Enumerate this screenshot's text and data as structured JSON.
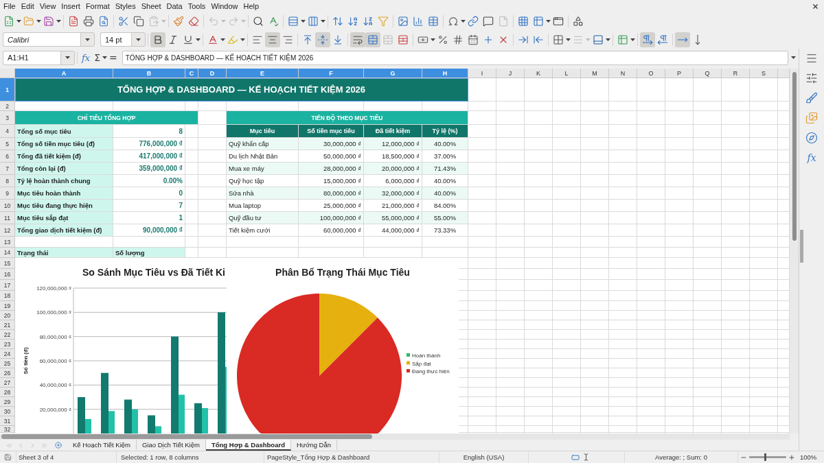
{
  "menu_bar": {
    "items": [
      "File",
      "Edit",
      "View",
      "Insert",
      "Format",
      "Styles",
      "Sheet",
      "Data",
      "Tools",
      "Window",
      "Help"
    ]
  },
  "standard_toolbar": {
    "paste_enabled": false,
    "undo_enabled": false,
    "redo_enabled": false,
    "headers_footers_enabled": false
  },
  "formatting_toolbar": {
    "font_name": "Calibri",
    "font_size": "14 pt",
    "bold": true,
    "italic": false,
    "underline": false,
    "align_left": false,
    "align_center": true,
    "align_right": false,
    "valign_top": false,
    "valign_center": true,
    "valign_bottom": false,
    "wrap_text": true,
    "merge_center": true,
    "merge_enabled": false,
    "border_style_enabled": false,
    "left_to_right": true,
    "right_to_left": false,
    "text_horizontal": true,
    "text_vertical": false
  },
  "formula_bar": {
    "name_box": "A1:H1",
    "function_wizard": "fx",
    "sum": "Σ",
    "formula": "=",
    "content": "TỔNG HỢP & DASHBOARD — KẾ HOẠCH TIẾT KIỆM 2026"
  },
  "sheet": {
    "columns": [
      {
        "label": "A",
        "selected": true
      },
      {
        "label": "B",
        "selected": true
      },
      {
        "label": "C",
        "selected": true
      },
      {
        "label": "D",
        "selected": true
      },
      {
        "label": "E",
        "selected": true
      },
      {
        "label": "F",
        "selected": true
      },
      {
        "label": "G",
        "selected": true
      },
      {
        "label": "H",
        "selected": true
      },
      {
        "label": "I",
        "selected": false
      },
      {
        "label": "J",
        "selected": false
      },
      {
        "label": "K",
        "selected": false
      },
      {
        "label": "L",
        "selected": false
      },
      {
        "label": "M",
        "selected": false
      },
      {
        "label": "N",
        "selected": false
      },
      {
        "label": "O",
        "selected": false
      },
      {
        "label": "P",
        "selected": false
      },
      {
        "label": "Q",
        "selected": false
      },
      {
        "label": "R",
        "selected": false
      },
      {
        "label": "S",
        "selected": false
      }
    ],
    "rows": [
      {
        "label": "1",
        "selected": true
      },
      {
        "label": "2",
        "selected": false
      },
      {
        "label": "3",
        "selected": false
      },
      {
        "label": "4",
        "selected": false
      },
      {
        "label": "5",
        "selected": false
      },
      {
        "label": "6",
        "selected": false
      },
      {
        "label": "7",
        "selected": false
      },
      {
        "label": "8",
        "selected": false
      },
      {
        "label": "9",
        "selected": false
      },
      {
        "label": "10",
        "selected": false
      },
      {
        "label": "11",
        "selected": false
      },
      {
        "label": "12",
        "selected": false
      },
      {
        "label": "13",
        "selected": false
      },
      {
        "label": "14",
        "selected": false
      },
      {
        "label": "15",
        "selected": false
      },
      {
        "label": "16",
        "selected": false
      },
      {
        "label": "17",
        "selected": false
      },
      {
        "label": "18",
        "selected": false
      },
      {
        "label": "19",
        "selected": false
      },
      {
        "label": "20",
        "selected": false
      },
      {
        "label": "21",
        "selected": false
      },
      {
        "label": "22",
        "selected": false
      },
      {
        "label": "23",
        "selected": false
      },
      {
        "label": "24",
        "selected": false
      },
      {
        "label": "25",
        "selected": false
      },
      {
        "label": "26",
        "selected": false
      },
      {
        "label": "27",
        "selected": false
      },
      {
        "label": "28",
        "selected": false
      },
      {
        "label": "29",
        "selected": false
      },
      {
        "label": "30",
        "selected": false
      },
      {
        "label": "31",
        "selected": false
      },
      {
        "label": "32",
        "selected": false
      }
    ],
    "title": "TỔNG HỢP & DASHBOARD — KẾ HOẠCH TIẾT KIỆM 2026",
    "summary": {
      "header": "CHỈ TIÊU TỔNG HỢP",
      "items": [
        {
          "label": "Tổng số mục tiêu",
          "value": "8"
        },
        {
          "label": "Tổng số tiền mục tiêu (đ)",
          "value": "776,000,000 ₫"
        },
        {
          "label": "Tổng đã tiết kiệm (đ)",
          "value": "417,000,000 ₫"
        },
        {
          "label": "Tổng còn lại (đ)",
          "value": "359,000,000 ₫"
        },
        {
          "label": "Tỷ lệ hoàn thành chung",
          "value": "0.00%"
        },
        {
          "label": "Mục tiêu hoàn thành",
          "value": "0"
        },
        {
          "label": "Mục tiêu đang thực hiện",
          "value": "7"
        },
        {
          "label": "Mục tiêu sắp đạt",
          "value": "1"
        },
        {
          "label": "Tổng giao dịch tiết kiệm (đ)",
          "value": "90,000,000 ₫"
        }
      ]
    },
    "progress": {
      "header": "TIẾN ĐỘ THEO MỤC TIÊU",
      "columns": [
        "Mục tiêu",
        "Số tiền mục tiêu",
        "Đã tiết kiệm",
        "Tỷ lệ (%)"
      ],
      "rows": [
        {
          "goal": "Quỹ khẩn cấp",
          "target": "30,000,000 ₫",
          "saved": "12,000,000 ₫",
          "ratio": "40.00%"
        },
        {
          "goal": "Du lịch Nhật Bản",
          "target": "50,000,000 ₫",
          "saved": "18,500,000 ₫",
          "ratio": "37.00%"
        },
        {
          "goal": "Mua xe máy",
          "target": "28,000,000 ₫",
          "saved": "20,000,000 ₫",
          "ratio": "71.43%"
        },
        {
          "goal": "Quỹ học tập",
          "target": "15,000,000 ₫",
          "saved": "6,000,000 ₫",
          "ratio": "40.00%"
        },
        {
          "goal": "Sửa nhà",
          "target": "80,000,000 ₫",
          "saved": "32,000,000 ₫",
          "ratio": "40.00%"
        },
        {
          "goal": "Mua laptop",
          "target": "25,000,000 ₫",
          "saved": "21,000,000 ₫",
          "ratio": "84.00%"
        },
        {
          "goal": "Quỹ đầu tư",
          "target": "100,000,000 ₫",
          "saved": "55,000,000 ₫",
          "ratio": "55.00%"
        },
        {
          "goal": "Tiết kiệm cưới",
          "target": "60,000,000 ₫",
          "saved": "44,000,000 ₫",
          "ratio": "73.33%"
        }
      ]
    },
    "status_table": {
      "columns": [
        "Trạng thái",
        "Số lượng"
      ]
    },
    "bar_chart": {
      "chart_data": {
        "type": "bar",
        "title": "So Sánh Mục Tiêu vs Đã Tiết Ki",
        "ylabel": "Số tiền (đ)",
        "ylim": [
          0,
          120000000
        ],
        "yticks": [
          {
            "value": 20000000,
            "label": "20,000,000 ₫"
          },
          {
            "value": 40000000,
            "label": "40,000,000 ₫"
          },
          {
            "value": 60000000,
            "label": "60,000,000 ₫"
          },
          {
            "value": 80000000,
            "label": "80,000,000 ₫"
          },
          {
            "value": 100000000,
            "label": "100,000,000 ₫"
          },
          {
            "value": 120000000,
            "label": "120,000,000 ₫"
          }
        ],
        "grid": true,
        "series": [
          {
            "color": "#127a6e",
            "values": [
              30000000,
              50000000,
              28000000,
              15000000,
              80000000,
              25000000,
              100000000
            ]
          },
          {
            "color": "#22c1a9",
            "values": [
              12000000,
              18500000,
              20000000,
              6000000,
              32000000,
              21000000,
              55000000
            ]
          }
        ]
      }
    },
    "pie_chart": {
      "chart_data": {
        "type": "pie",
        "title": "Phân Bổ Trạng Thái Mục Tiêu",
        "categories": [
          "Hoàn thành",
          "Sắp đạt",
          "Đang thực hiện"
        ],
        "values": [
          0,
          12.5,
          87.5
        ],
        "colors": [
          "#2ebb6c",
          "#e6b10e",
          "#da2a24"
        ],
        "legend": "right"
      }
    }
  },
  "sheet_tab_bar": {
    "navigation_enabled": false,
    "tabs": [
      {
        "label": "Kế Hoạch Tiết Kiệm",
        "selected": false
      },
      {
        "label": "Giao Dịch Tiết Kiệm",
        "selected": false
      },
      {
        "label": "Tổng Hợp & Dashboard",
        "selected": true
      },
      {
        "label": "Hướng Dẫn",
        "selected": false
      }
    ]
  },
  "sidebar": {
    "functions": "fx"
  },
  "status_bar": {
    "sheet": "Sheet 3 of 4",
    "selection": "Selected: 1 row, 8 columns",
    "page_style": "PageStyle_Tổng Hợp & Dashboard",
    "language": "English (USA)",
    "statistics": "Average: ; Sum: 0",
    "zoom": {
      "level": 0.42,
      "label": "100%"
    }
  }
}
